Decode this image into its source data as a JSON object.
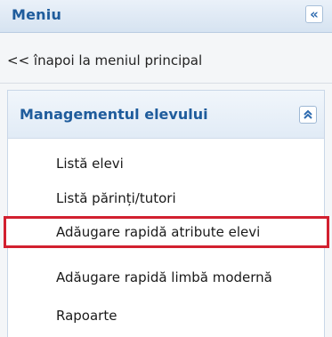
{
  "menu": {
    "title": "Meniu",
    "collapse_icon": "double-chevron-left-icon",
    "collapse_glyph": "«"
  },
  "back_link": {
    "label": "<< înapoi la meniul principal"
  },
  "section": {
    "title": "Managementul elevului",
    "toggle_icon": "double-chevron-up-icon",
    "toggle_glyph": "⌃",
    "items": [
      {
        "label": "Listă elevi"
      },
      {
        "label": "Listă părinți/tutori"
      },
      {
        "label": "Adăugare rapidă atribute elevi",
        "highlighted": true
      },
      {
        "label": "Adăugare rapidă limbă modernă"
      },
      {
        "label": "Rapoarte"
      }
    ]
  },
  "colors": {
    "accent": "#1f5c9c",
    "highlight_border": "#d2202f"
  }
}
